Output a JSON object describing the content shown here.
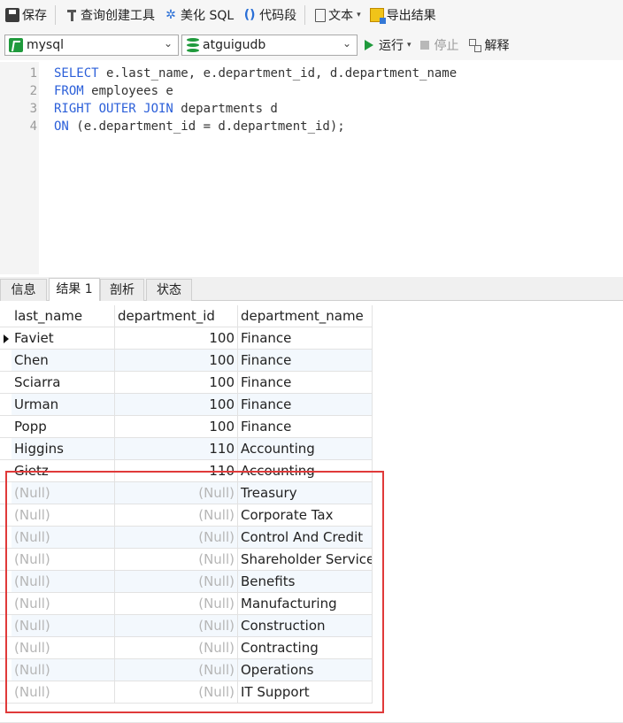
{
  "toolbar": {
    "save": "保存",
    "query_builder": "查询创建工具",
    "beautify": "美化 SQL",
    "snippet": "代码段",
    "text": "文本",
    "export": "导出结果"
  },
  "selectors": {
    "connection": "mysql",
    "database": "atguigudb"
  },
  "actions": {
    "run": "运行",
    "stop": "停止",
    "explain": "解释"
  },
  "editor": {
    "lines": [
      {
        "num": "1",
        "parts": [
          {
            "t": "SELECT",
            "kw": true
          },
          {
            "t": " e.last_name, e.department_id, d.department_name",
            "kw": false
          }
        ]
      },
      {
        "num": "2",
        "parts": [
          {
            "t": "FROM",
            "kw": true
          },
          {
            "t": " employees e",
            "kw": false
          }
        ]
      },
      {
        "num": "3",
        "parts": [
          {
            "t": "RIGHT OUTER JOIN",
            "kw": true
          },
          {
            "t": " departments d",
            "kw": false
          }
        ]
      },
      {
        "num": "4",
        "parts": [
          {
            "t": "ON",
            "kw": true
          },
          {
            "t": " (e.department_id = d.department_id);",
            "kw": false
          }
        ]
      }
    ]
  },
  "tabs": [
    "信息",
    "结果 1",
    "剖析",
    "状态"
  ],
  "active_tab": "结果 1",
  "grid": {
    "columns": [
      "last_name",
      "department_id",
      "department_name"
    ],
    "rows": [
      {
        "last_name": "Faviet",
        "department_id": "100",
        "department_name": "Finance",
        "current": true
      },
      {
        "last_name": "Chen",
        "department_id": "100",
        "department_name": "Finance"
      },
      {
        "last_name": "Sciarra",
        "department_id": "100",
        "department_name": "Finance"
      },
      {
        "last_name": "Urman",
        "department_id": "100",
        "department_name": "Finance"
      },
      {
        "last_name": "Popp",
        "department_id": "100",
        "department_name": "Finance"
      },
      {
        "last_name": "Higgins",
        "department_id": "110",
        "department_name": "Accounting"
      },
      {
        "last_name": "Gietz",
        "department_id": "110",
        "department_name": "Accounting"
      },
      {
        "last_name": "(Null)",
        "department_id": "(Null)",
        "department_name": "Treasury"
      },
      {
        "last_name": "(Null)",
        "department_id": "(Null)",
        "department_name": "Corporate Tax"
      },
      {
        "last_name": "(Null)",
        "department_id": "(Null)",
        "department_name": "Control And Credit"
      },
      {
        "last_name": "(Null)",
        "department_id": "(Null)",
        "department_name": "Shareholder Services"
      },
      {
        "last_name": "(Null)",
        "department_id": "(Null)",
        "department_name": "Benefits"
      },
      {
        "last_name": "(Null)",
        "department_id": "(Null)",
        "department_name": "Manufacturing"
      },
      {
        "last_name": "(Null)",
        "department_id": "(Null)",
        "department_name": "Construction"
      },
      {
        "last_name": "(Null)",
        "department_id": "(Null)",
        "department_name": "Contracting"
      },
      {
        "last_name": "(Null)",
        "department_id": "(Null)",
        "department_name": "Operations"
      },
      {
        "last_name": "(Null)",
        "department_id": "(Null)",
        "department_name": "IT Support"
      }
    ]
  },
  "colors": {
    "keyword": "#2b5fd9",
    "null_text": "#b6b6b6",
    "highlight": "#e03a3a",
    "run_icon": "#1f9a3c"
  }
}
